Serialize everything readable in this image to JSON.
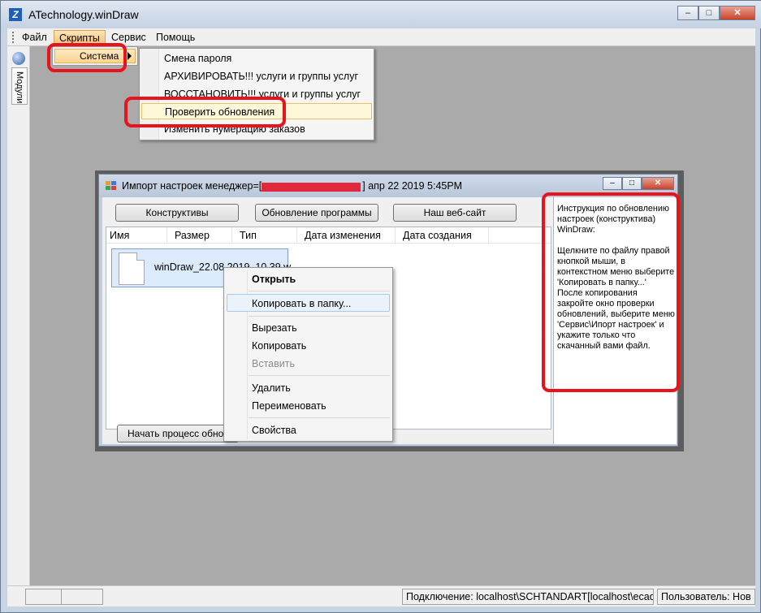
{
  "window": {
    "title": "ATechnology.winDraw",
    "icon_label": "Z",
    "buttons": [
      "minimize",
      "maximize",
      "close"
    ]
  },
  "menubar": {
    "items": [
      "Файл",
      "Скрипты",
      "Сервис",
      "Помощь"
    ],
    "active": "Скрипты"
  },
  "left_panel": {
    "tab_label": "Модули"
  },
  "scripts_menu": {
    "item": "Система"
  },
  "system_submenu": {
    "items": [
      "Смена пароля",
      "АРХИВИРОВАТЬ!!! услуги и группы услуг",
      "ВОССТАНОВИТЬ!!! услуги и группы услуг",
      "Проверить обновления",
      "Изменить нумерацию заказов"
    ],
    "highlighted": "Проверить обновления"
  },
  "dialog": {
    "title_prefix": "Импорт настроек менеджер=[",
    "title_suffix": "] апр 22 2019  5:45PM",
    "buttons": [
      "Конструктивы",
      "Обновление программы",
      "Наш веб-сайт"
    ],
    "columns": [
      "Имя",
      "Размер",
      "Тип",
      "Дата изменения",
      "Дата создания"
    ],
    "file_name": "winDraw_22.08.2019_10.39.w...",
    "start_button": "Начать процесс обновл",
    "instruction": "Инструкция по обновлению настроек (конструктива) WinDraw:\n\nЩелкните по файлу правой кнопкой мыши, в контекстном меню выберите 'Копировать в папку...'\nПосле копирования закройте окно проверки обновлений, выберите меню 'Сервис\\Ипорт настроек' и укажите только что скачанный вами файл."
  },
  "context_menu": {
    "items": [
      {
        "label": "Открыть",
        "bold": true
      },
      {
        "label": "Копировать в папку...",
        "highlighted": true
      },
      {
        "label": "Вырезать"
      },
      {
        "label": "Копировать"
      },
      {
        "label": "Вставить",
        "disabled": true
      },
      {
        "label": "Удалить"
      },
      {
        "label": "Переименовать"
      },
      {
        "label": "Свойства"
      }
    ]
  },
  "statusbar": {
    "connection": "Подключение: localhost\\SCHTANDART[localhost\\ecad]",
    "user": "Пользователь: Нов"
  },
  "colors": {
    "annotation_red": "#e8131b",
    "menu_highlight": "#fff8d8",
    "selection": "#dcebfc"
  }
}
